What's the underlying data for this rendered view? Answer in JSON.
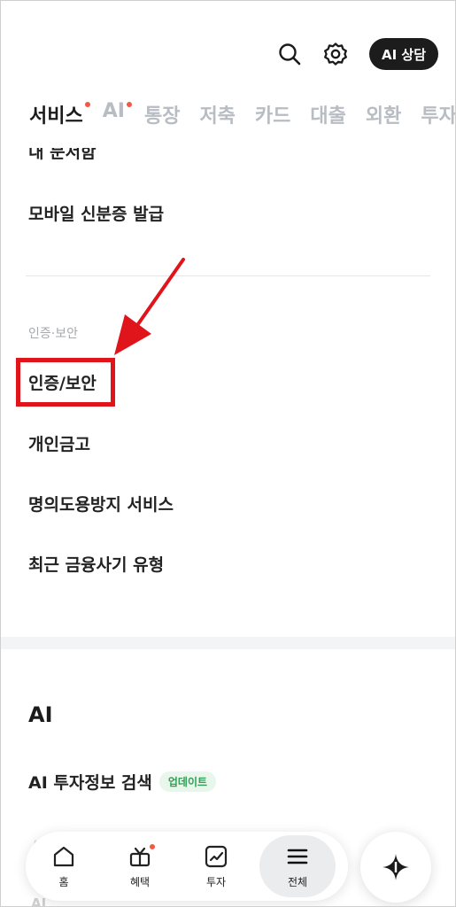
{
  "header": {
    "search_icon": "search-icon",
    "settings_icon": "gear-icon",
    "ai_button_label": "AI 상담"
  },
  "tabs": [
    {
      "label": "서비스",
      "active": true,
      "dot": true
    },
    {
      "label": "AI",
      "active": false,
      "dot": true
    },
    {
      "label": "통장",
      "active": false
    },
    {
      "label": "저축",
      "active": false
    },
    {
      "label": "카드",
      "active": false
    },
    {
      "label": "대출",
      "active": false
    },
    {
      "label": "외환",
      "active": false
    },
    {
      "label": "투자",
      "active": false
    }
  ],
  "list": {
    "cut_item": "내 문서함",
    "items_top": [
      "모바일 신분증 발급"
    ],
    "section_label": "인증·보안",
    "security_items": [
      "인증/보안",
      "개인금고",
      "명의도용방지 서비스",
      "최근 금융사기 유형"
    ],
    "ai_section_title": "AI",
    "ai_items": [
      {
        "label": "AI 투자정보 검색",
        "badge": "업데이트"
      }
    ]
  },
  "bottom_nav": {
    "items": [
      {
        "label": "홈",
        "icon": "home-icon"
      },
      {
        "label": "혜택",
        "icon": "gift-icon",
        "dot": true
      },
      {
        "label": "투자",
        "icon": "chart-icon"
      },
      {
        "label": "전체",
        "icon": "menu-icon",
        "active": true
      }
    ],
    "fab_icon": "sparkle-icon"
  },
  "annotation": {
    "highlight_color": "#e0141b"
  }
}
